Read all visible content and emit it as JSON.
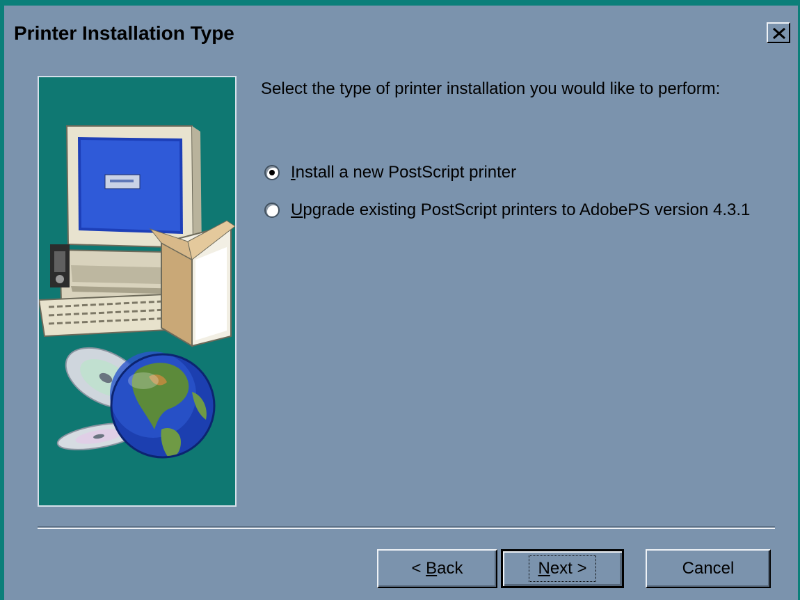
{
  "window": {
    "title": "Printer Installation Type",
    "close_symbol": "×",
    "colors": {
      "frame": "#0b7f7a",
      "face": "#7b93ad",
      "image_bg": "#0f7872"
    }
  },
  "content": {
    "prompt": "Select the type of printer installation you would like to perform:",
    "options": [
      {
        "accel": "I",
        "rest": "nstall a new PostScript printer",
        "checked": true
      },
      {
        "accel": "U",
        "rest": "pgrade existing PostScript printers to AdobePS version 4.3.1",
        "checked": false
      }
    ]
  },
  "buttons": {
    "back": {
      "prefix": "< ",
      "accel": "B",
      "rest": "ack"
    },
    "next": {
      "accel": "N",
      "rest": "ext >"
    },
    "cancel": {
      "label": "Cancel"
    }
  },
  "icons": {
    "close": "close-icon",
    "illustration": [
      "computer-icon",
      "software-box-icon",
      "cd-icon",
      "globe-icon"
    ]
  }
}
